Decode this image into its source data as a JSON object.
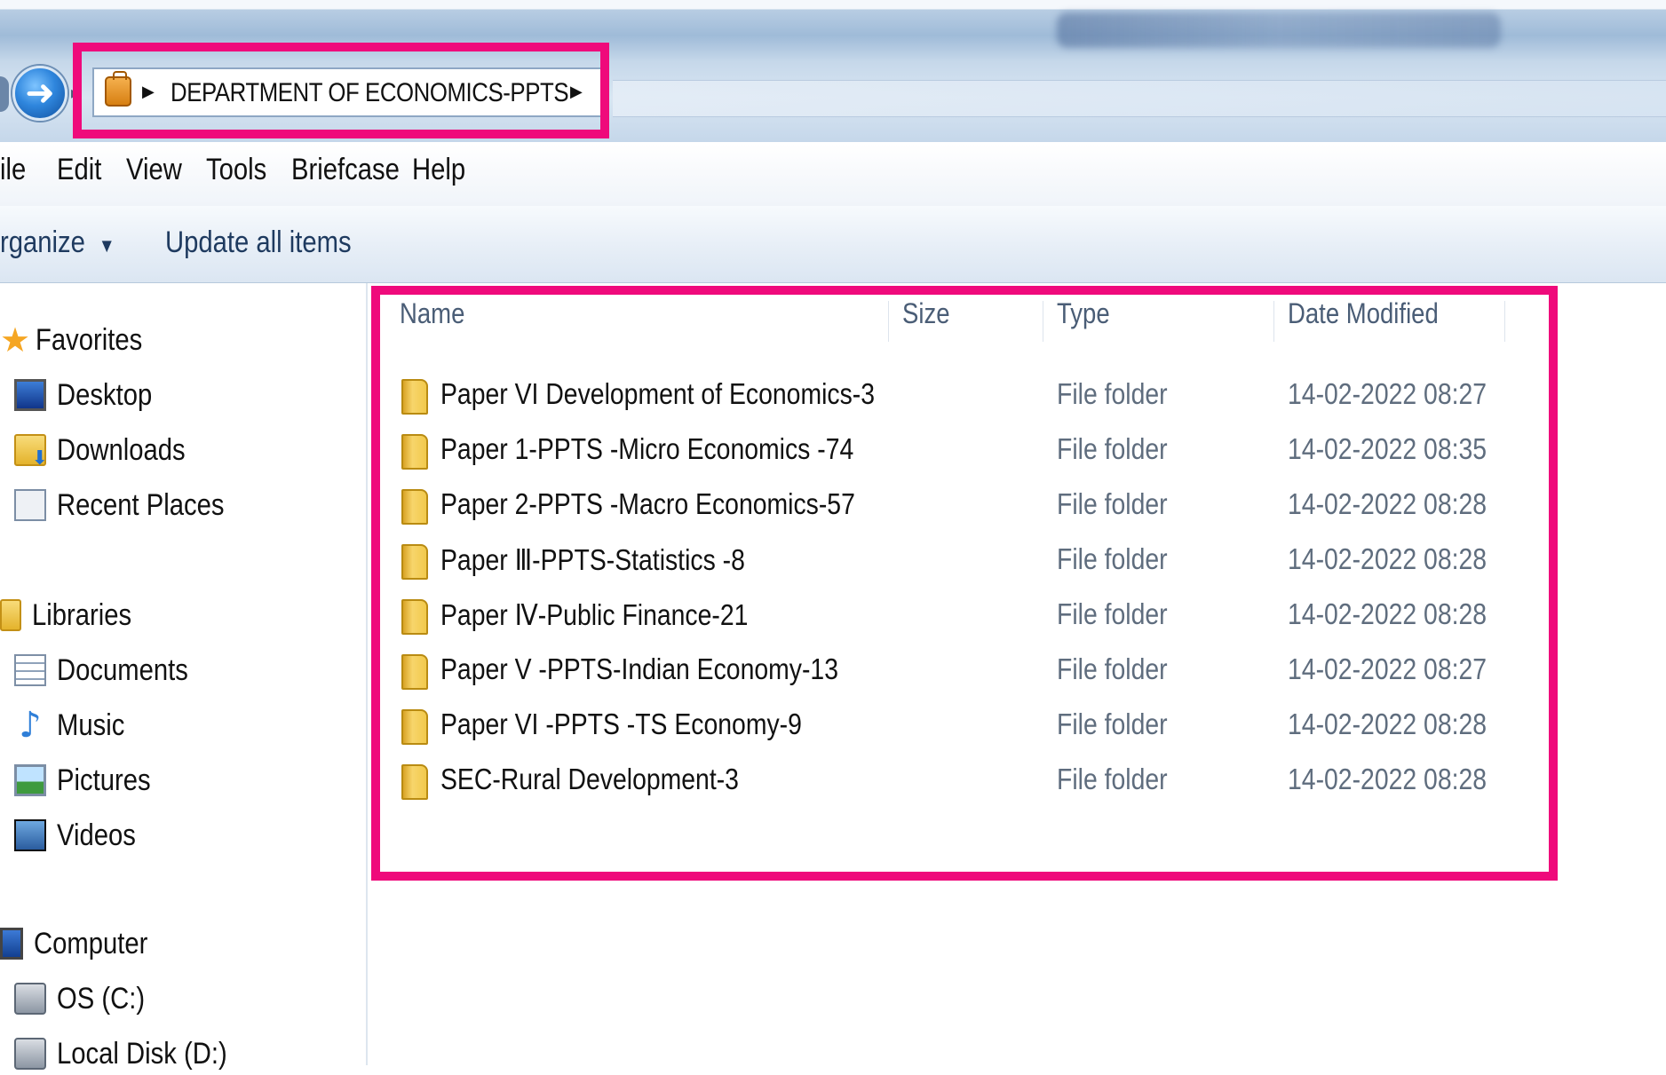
{
  "window": {
    "title": ""
  },
  "address_bar": {
    "breadcrumb": "DEPARTMENT OF ECONOMICS-PPTS",
    "folder_icon": "briefcase-icon"
  },
  "menu": {
    "items": [
      "ile",
      "Edit",
      "View",
      "Tools",
      "Briefcase",
      "Help"
    ]
  },
  "toolbar": {
    "organize_label": "rganize",
    "organize_arrow": "▼",
    "update_label": "Update all items"
  },
  "nav": {
    "favorites": {
      "label": "Favorites",
      "items": [
        {
          "label": "Desktop",
          "icon": "desktop-icon"
        },
        {
          "label": "Downloads",
          "icon": "downloads-icon"
        },
        {
          "label": "Recent Places",
          "icon": "recent-places-icon"
        }
      ]
    },
    "libraries": {
      "label": "Libraries",
      "items": [
        {
          "label": "Documents",
          "icon": "documents-icon"
        },
        {
          "label": "Music",
          "icon": "music-icon"
        },
        {
          "label": "Pictures",
          "icon": "pictures-icon"
        },
        {
          "label": "Videos",
          "icon": "videos-icon"
        }
      ]
    },
    "computer": {
      "label": "Computer",
      "items": [
        {
          "label": "OS (C:)",
          "icon": "drive-c-icon"
        },
        {
          "label": "Local Disk (D:)",
          "icon": "drive-d-icon"
        }
      ]
    }
  },
  "columns": {
    "name": "Name",
    "size": "Size",
    "type": "Type",
    "date": "Date Modified"
  },
  "files": [
    {
      "name": "Paper VI Development of Economics-3",
      "type": "File folder",
      "date": "14-02-2022 08:27"
    },
    {
      "name": "Paper 1-PPTS -Micro Economics -74",
      "type": "File folder",
      "date": "14-02-2022 08:35"
    },
    {
      "name": "Paper 2-PPTS -Macro Economics-57",
      "type": "File folder",
      "date": "14-02-2022 08:28"
    },
    {
      "name": "Paper Ⅲ-PPTS-Statistics  -8",
      "type": "File folder",
      "date": "14-02-2022 08:28"
    },
    {
      "name": "Paper Ⅳ-Public Finance-21",
      "type": "File folder",
      "date": "14-02-2022 08:28"
    },
    {
      "name": "Paper V -PPTS-Indian Economy-13",
      "type": "File folder",
      "date": "14-02-2022 08:27"
    },
    {
      "name": "Paper VI -PPTS -TS Economy-9",
      "type": "File folder",
      "date": "14-02-2022 08:28"
    },
    {
      "name": "SEC-Rural Development-3",
      "type": "File folder",
      "date": "14-02-2022 08:28"
    }
  ],
  "colors": {
    "highlight": "#ef0a7b",
    "folder": "#f2c94c",
    "meta_text": "#5f6d7e"
  }
}
